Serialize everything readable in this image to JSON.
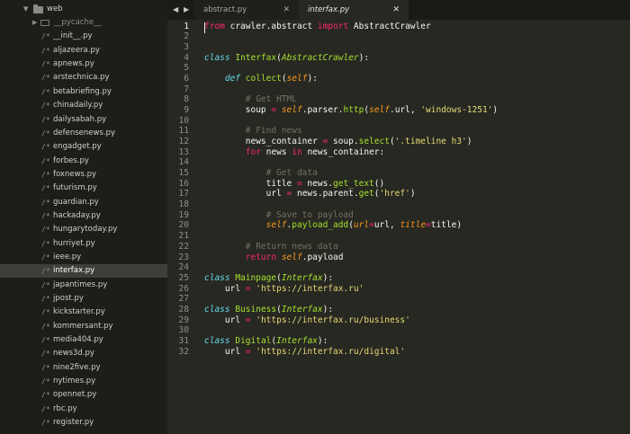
{
  "sidebar": {
    "root_folder": "web",
    "items": [
      {
        "type": "folder",
        "label": "__pycache__"
      },
      {
        "type": "file",
        "label": "__init__.py"
      },
      {
        "type": "file",
        "label": "aljazeera.py"
      },
      {
        "type": "file",
        "label": "apnews.py"
      },
      {
        "type": "file",
        "label": "arstechnica.py"
      },
      {
        "type": "file",
        "label": "betabriefing.py"
      },
      {
        "type": "file",
        "label": "chinadaily.py"
      },
      {
        "type": "file",
        "label": "dailysabah.py"
      },
      {
        "type": "file",
        "label": "defensenews.py"
      },
      {
        "type": "file",
        "label": "engadget.py"
      },
      {
        "type": "file",
        "label": "forbes.py"
      },
      {
        "type": "file",
        "label": "foxnews.py"
      },
      {
        "type": "file",
        "label": "futurism.py"
      },
      {
        "type": "file",
        "label": "guardian.py"
      },
      {
        "type": "file",
        "label": "hackaday.py"
      },
      {
        "type": "file",
        "label": "hungarytoday.py"
      },
      {
        "type": "file",
        "label": "hurriyet.py"
      },
      {
        "type": "file",
        "label": "ieee.py"
      },
      {
        "type": "file",
        "label": "interfax.py",
        "selected": true
      },
      {
        "type": "file",
        "label": "japantimes.py"
      },
      {
        "type": "file",
        "label": "jpost.py"
      },
      {
        "type": "file",
        "label": "kickstarter.py"
      },
      {
        "type": "file",
        "label": "kommersant.py"
      },
      {
        "type": "file",
        "label": "media404.py"
      },
      {
        "type": "file",
        "label": "news3d.py"
      },
      {
        "type": "file",
        "label": "nine2five.py"
      },
      {
        "type": "file",
        "label": "nytimes.py"
      },
      {
        "type": "file",
        "label": "opennet.py"
      },
      {
        "type": "file",
        "label": "rbc.py"
      },
      {
        "type": "file",
        "label": "register.py"
      }
    ]
  },
  "tabs": [
    {
      "label": "abstract.py",
      "active": false,
      "close": "✕"
    },
    {
      "label": "interfax.py",
      "active": true,
      "close": "✕"
    }
  ],
  "icons": {
    "nav_back": "◀",
    "nav_forward": "▶",
    "file_glyph": "/*",
    "disclosure_open": "▼",
    "disclosure_closed": "▶"
  },
  "editor": {
    "current_line": 1,
    "lines": [
      [
        [
          "kw",
          "from"
        ],
        [
          "p",
          " crawler.abstract "
        ],
        [
          "kw",
          "import"
        ],
        [
          "p",
          " AbstractCrawler"
        ]
      ],
      [],
      [],
      [
        [
          "def",
          "class"
        ],
        [
          "p",
          " "
        ],
        [
          "cls",
          "Interfax"
        ],
        [
          "p",
          "("
        ],
        [
          "inh",
          "AbstractCrawler"
        ],
        [
          "p",
          "):"
        ]
      ],
      [],
      [
        [
          "p",
          "    "
        ],
        [
          "def",
          "def"
        ],
        [
          "p",
          " "
        ],
        [
          "fn",
          "collect"
        ],
        [
          "p",
          "("
        ],
        [
          "self",
          "self"
        ],
        [
          "p",
          "):"
        ]
      ],
      [],
      [
        [
          "p",
          "        "
        ],
        [
          "cmt",
          "# Get HTML"
        ]
      ],
      [
        [
          "p",
          "        soup "
        ],
        [
          "op",
          "="
        ],
        [
          "p",
          " "
        ],
        [
          "self",
          "self"
        ],
        [
          "p",
          ".parser."
        ],
        [
          "fn",
          "http"
        ],
        [
          "p",
          "("
        ],
        [
          "self",
          "self"
        ],
        [
          "p",
          ".url, "
        ],
        [
          "str",
          "'windows-1251'"
        ],
        [
          "p",
          ")"
        ]
      ],
      [],
      [
        [
          "p",
          "        "
        ],
        [
          "cmt",
          "# Find news"
        ]
      ],
      [
        [
          "p",
          "        news_container "
        ],
        [
          "op",
          "="
        ],
        [
          "p",
          " soup."
        ],
        [
          "fn",
          "select"
        ],
        [
          "p",
          "("
        ],
        [
          "str",
          "'.timeline h3'"
        ],
        [
          "p",
          ")"
        ]
      ],
      [
        [
          "p",
          "        "
        ],
        [
          "kw",
          "for"
        ],
        [
          "p",
          " news "
        ],
        [
          "kw",
          "in"
        ],
        [
          "p",
          " news_container:"
        ]
      ],
      [],
      [
        [
          "p",
          "            "
        ],
        [
          "cmt",
          "# Get data"
        ]
      ],
      [
        [
          "p",
          "            title "
        ],
        [
          "op",
          "="
        ],
        [
          "p",
          " news."
        ],
        [
          "fn",
          "get_text"
        ],
        [
          "p",
          "()"
        ]
      ],
      [
        [
          "p",
          "            url "
        ],
        [
          "op",
          "="
        ],
        [
          "p",
          " news.parent."
        ],
        [
          "fn",
          "get"
        ],
        [
          "p",
          "("
        ],
        [
          "str",
          "'href'"
        ],
        [
          "p",
          ")"
        ]
      ],
      [],
      [
        [
          "p",
          "            "
        ],
        [
          "cmt",
          "# Save to payload"
        ]
      ],
      [
        [
          "p",
          "            "
        ],
        [
          "self",
          "self"
        ],
        [
          "p",
          "."
        ],
        [
          "fn",
          "payload_add"
        ],
        [
          "p",
          "("
        ],
        [
          "param",
          "url"
        ],
        [
          "op",
          "="
        ],
        [
          "p",
          "url, "
        ],
        [
          "param",
          "title"
        ],
        [
          "op",
          "="
        ],
        [
          "p",
          "title)"
        ]
      ],
      [],
      [
        [
          "p",
          "        "
        ],
        [
          "cmt",
          "# Return news data"
        ]
      ],
      [
        [
          "p",
          "        "
        ],
        [
          "kw",
          "return"
        ],
        [
          "p",
          " "
        ],
        [
          "self",
          "self"
        ],
        [
          "p",
          ".payload"
        ]
      ],
      [],
      [
        [
          "def",
          "class"
        ],
        [
          "p",
          " "
        ],
        [
          "cls",
          "Mainpage"
        ],
        [
          "p",
          "("
        ],
        [
          "inh",
          "Interfax"
        ],
        [
          "p",
          "):"
        ]
      ],
      [
        [
          "p",
          "    url "
        ],
        [
          "op",
          "="
        ],
        [
          "p",
          " "
        ],
        [
          "str",
          "'https://interfax.ru'"
        ]
      ],
      [],
      [
        [
          "def",
          "class"
        ],
        [
          "p",
          " "
        ],
        [
          "cls",
          "Business"
        ],
        [
          "p",
          "("
        ],
        [
          "inh",
          "Interfax"
        ],
        [
          "p",
          "):"
        ]
      ],
      [
        [
          "p",
          "    url "
        ],
        [
          "op",
          "="
        ],
        [
          "p",
          " "
        ],
        [
          "str",
          "'https://interfax.ru/business'"
        ]
      ],
      [],
      [
        [
          "def",
          "class"
        ],
        [
          "p",
          " "
        ],
        [
          "cls",
          "Digital"
        ],
        [
          "p",
          "("
        ],
        [
          "inh",
          "Interfax"
        ],
        [
          "p",
          "):"
        ]
      ],
      [
        [
          "p",
          "    url "
        ],
        [
          "op",
          "="
        ],
        [
          "p",
          " "
        ],
        [
          "str",
          "'https://interfax.ru/digital'"
        ]
      ]
    ]
  }
}
